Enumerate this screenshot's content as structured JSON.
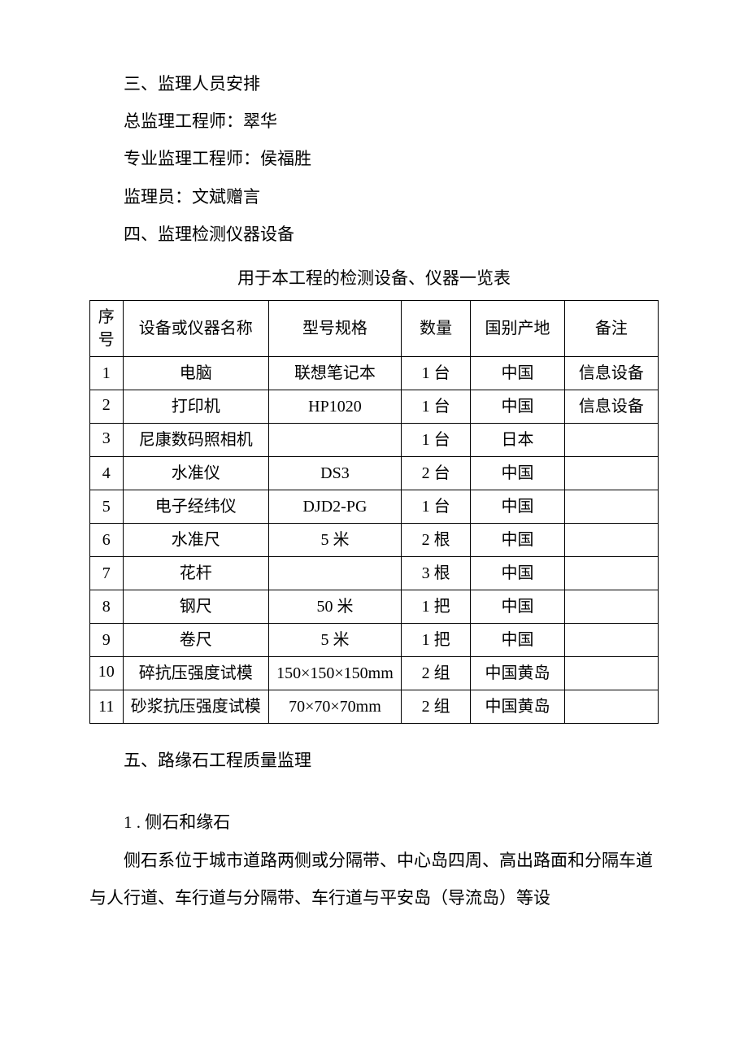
{
  "section3": {
    "heading": "三、监理人员安排",
    "line1": "总监理工程师：翠华",
    "line2": "专业监理工程师：侯福胜",
    "line3": "监理员：文斌赠言"
  },
  "section4": {
    "heading": "四、监理检测仪器设备",
    "table_caption": "用于本工程的检测设备、仪器一览表",
    "headers": {
      "idx": "序号",
      "name": "设备或仪器名称",
      "spec": "型号规格",
      "qty": "数量",
      "origin": "国别产地",
      "note": "备注"
    },
    "rows": [
      {
        "idx": "1",
        "name": "电脑",
        "spec": "联想笔记本",
        "qty": "1 台",
        "origin": "中国",
        "note": "信息设备"
      },
      {
        "idx": "2",
        "name": "打印机",
        "spec": "HP1020",
        "qty": "1 台",
        "origin": "中国",
        "note": "信息设备"
      },
      {
        "idx": "3",
        "name": "尼康数码照相机",
        "spec": "",
        "qty": "1 台",
        "origin": "日本",
        "note": ""
      },
      {
        "idx": "4",
        "name": "水准仪",
        "spec": "DS3",
        "qty": "2 台",
        "origin": "中国",
        "note": ""
      },
      {
        "idx": "5",
        "name": "电子经纬仪",
        "spec": "DJD2-PG",
        "qty": "1 台",
        "origin": "中国",
        "note": ""
      },
      {
        "idx": "6",
        "name": "水准尺",
        "spec": "5 米",
        "qty": "2 根",
        "origin": "中国",
        "note": ""
      },
      {
        "idx": "7",
        "name": "花杆",
        "spec": "",
        "qty": "3 根",
        "origin": "中国",
        "note": ""
      },
      {
        "idx": "8",
        "name": "钢尺",
        "spec": "50 米",
        "qty": "1 把",
        "origin": "中国",
        "note": ""
      },
      {
        "idx": "9",
        "name": "卷尺",
        "spec": "5 米",
        "qty": "1 把",
        "origin": "中国",
        "note": ""
      },
      {
        "idx": "10",
        "name": "碎抗压强度试模",
        "spec": "150×150×150mm",
        "qty": "2 组",
        "origin": "中国黄岛",
        "note": ""
      },
      {
        "idx": "11",
        "name": "砂浆抗压强度试模",
        "spec": "70×70×70mm",
        "qty": "2 组",
        "origin": "中国黄岛",
        "note": ""
      }
    ]
  },
  "section5": {
    "heading": "五、路缘石工程质量监理",
    "sub1": "1 . 侧石和缘石",
    "para1": "侧石系位于城市道路两侧或分隔带、中心岛四周、高出路面和分隔车道与人行道、车行道与分隔带、车行道与平安岛（导流岛）等设"
  }
}
